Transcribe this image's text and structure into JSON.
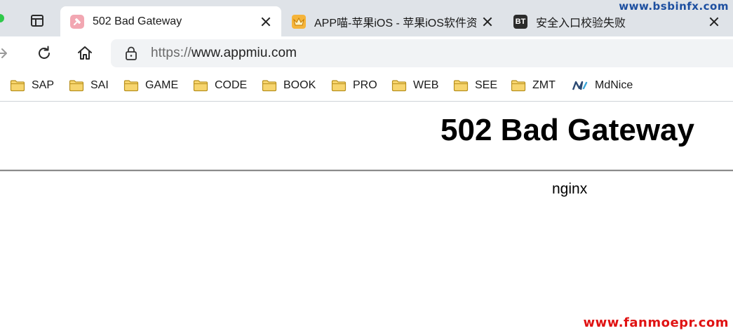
{
  "tabs": [
    {
      "title": "502 Bad Gateway",
      "favicon": "pink-pin-icon",
      "active": true
    },
    {
      "title": "APP喵-苹果iOS - 苹果iOS软件资",
      "favicon": "crown-app-icon",
      "active": false
    },
    {
      "title": "安全入口校验失败",
      "favicon": "bt-panel-icon",
      "favicon_text": "BT",
      "active": false
    }
  ],
  "toolbar": {
    "url_scheme": "https://",
    "url_host": "www.appmiu.com"
  },
  "bookmarks": [
    {
      "label": "SAP",
      "icon": "folder-icon"
    },
    {
      "label": "SAI",
      "icon": "folder-icon"
    },
    {
      "label": "GAME",
      "icon": "folder-icon"
    },
    {
      "label": "CODE",
      "icon": "folder-icon"
    },
    {
      "label": "BOOK",
      "icon": "folder-icon"
    },
    {
      "label": "PRO",
      "icon": "folder-icon"
    },
    {
      "label": "WEB",
      "icon": "folder-icon"
    },
    {
      "label": "SEE",
      "icon": "folder-icon"
    },
    {
      "label": "ZMT",
      "icon": "folder-icon"
    },
    {
      "label": "MdNice",
      "icon": "mdnice-logo-icon"
    }
  ],
  "page": {
    "heading": "502 Bad Gateway",
    "server": "nginx"
  },
  "watermarks": {
    "top": "www.bsbinfx.com",
    "bottom": "www.fanmoepr.com"
  },
  "colors": {
    "tabstrip_bg": "#dfe3e8",
    "folder_fill": "#f7d56e",
    "folder_stroke": "#b8901e",
    "watermark_top": "#1d4fa0",
    "watermark_bottom": "#e01313"
  }
}
